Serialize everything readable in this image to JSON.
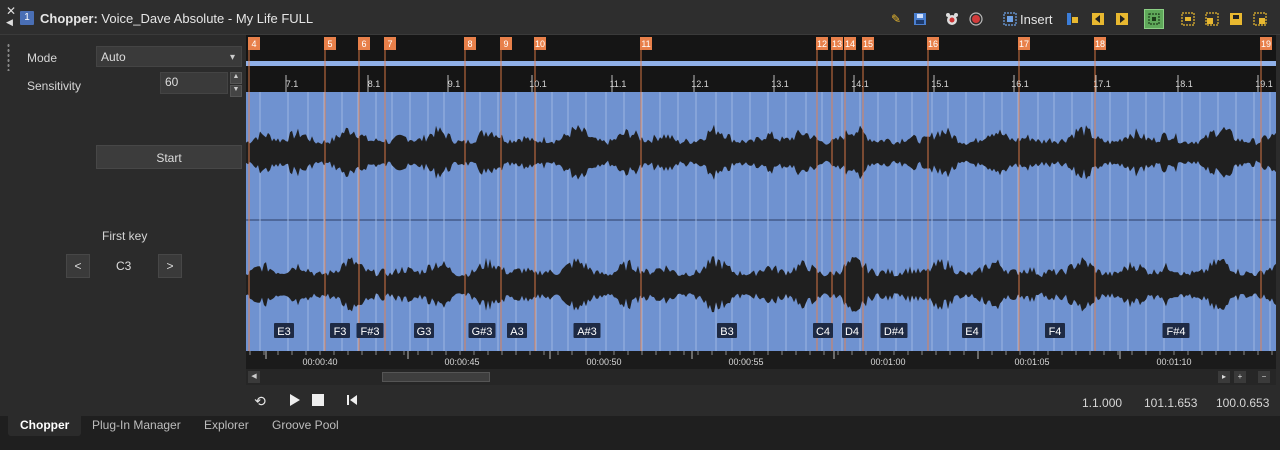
{
  "title": {
    "prefix": "Chopper:",
    "track": "Voice_Dave Absolute - My Life FULL",
    "track_number": "1"
  },
  "toolbar": {
    "insert_label": "Insert"
  },
  "panel": {
    "mode_label": "Mode",
    "mode_value": "Auto",
    "sensitivity_label": "Sensitivity",
    "sensitivity_value": "60",
    "start_label": "Start",
    "first_key_label": "First key",
    "first_key_value": "C3",
    "prev_label": "<",
    "next_label": ">"
  },
  "markers": [
    "4",
    "5",
    "6",
    "7",
    "8",
    "9",
    "10",
    "11",
    "12",
    "13",
    "14",
    "15",
    "16",
    "17",
    "18",
    "19"
  ],
  "bars": [
    "7.1",
    "8.1",
    "9.1",
    "10.1",
    "11.1",
    "12.1",
    "13.1",
    "14.1",
    "15.1",
    "16.1",
    "17.1",
    "18.1",
    "19.1"
  ],
  "keys": [
    "E3",
    "F3",
    "F#3",
    "G3",
    "G#3",
    "A3",
    "A#3",
    "B3",
    "C4",
    "D4",
    "D#4",
    "E4",
    "F4",
    "F#4"
  ],
  "times": [
    "00:00:40",
    "00:00:45",
    "00:00:50",
    "00:00:55",
    "00:01:00",
    "00:01:05",
    "00:01:10"
  ],
  "transport": {
    "position1": "1.1.000",
    "position2": "101.1.653",
    "position3": "100.0.653"
  },
  "tabs": [
    "Chopper",
    "Plug-In Manager",
    "Explorer",
    "Groove Pool"
  ],
  "colors": {
    "waveform_bg": "#6f92d0",
    "waveform": "#1f1f1f",
    "marker": "#e8804a",
    "accent": "#4a6fb5"
  }
}
